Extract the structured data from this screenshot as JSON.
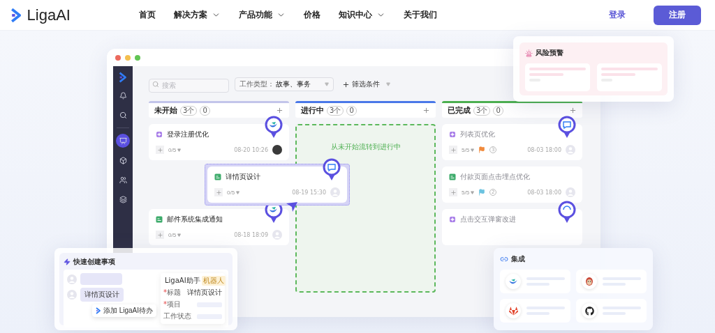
{
  "nav": {
    "logo": "LigaAI",
    "items": [
      {
        "label": "首页",
        "dropdown": false
      },
      {
        "label": "解决方案",
        "dropdown": true
      },
      {
        "label": "产品功能",
        "dropdown": true
      },
      {
        "label": "价格",
        "dropdown": false
      },
      {
        "label": "知识中心",
        "dropdown": true
      },
      {
        "label": "关于我们",
        "dropdown": false
      }
    ],
    "login": "登录",
    "signup": "注册"
  },
  "app": {
    "sidebar": {
      "items": [
        {
          "kind": "bell",
          "selected": false
        },
        {
          "kind": "search",
          "selected": false
        },
        {
          "kind": "board",
          "selected": true
        },
        {
          "kind": "cube",
          "selected": false
        },
        {
          "kind": "team",
          "selected": false
        },
        {
          "kind": "layers",
          "selected": false
        }
      ]
    },
    "search": {
      "placeholder": "搜索"
    },
    "filter": {
      "label": "工作类型：",
      "value": "故事、事务"
    },
    "filter_button": "筛选条件",
    "columns": [
      {
        "title": "未开始",
        "count": "3个",
        "badge": "0",
        "color": "#c3c5ea",
        "faded": false,
        "cards": [
          {
            "kind": "story",
            "title": "登录注册优化",
            "progress": "0/5",
            "date": "08-20 10:26",
            "avatar": {
              "kind": "photo"
            },
            "pin": {
              "kind": "bot"
            }
          },
          {
            "kind": "task",
            "title": "邮件系统集成通知",
            "progress": "0/5",
            "date": "08-18 18:09",
            "avatar": {
              "kind": "blank"
            },
            "pin": {
              "kind": "bot"
            }
          }
        ],
        "dragged_card": {
          "kind": "task",
          "title": "详情页设计",
          "progress": "0/5",
          "date": "08-19 15:30",
          "avatar": {
            "kind": "blank"
          },
          "pin": {
            "kind": "chat"
          }
        }
      },
      {
        "title": "进行中",
        "count": "3个",
        "badge": "0",
        "color": "#4a78e8",
        "drop_hint": "从未开始流转到进行中"
      },
      {
        "title": "已完成",
        "count": "3个",
        "badge": "0",
        "color": "#4caf50",
        "faded": true,
        "cards": [
          {
            "kind": "story",
            "title": "列表页优化",
            "progress": "5/5",
            "flag": {
              "color": "#f08a3c"
            },
            "comments": "3",
            "date": "08-03 18:00",
            "avatar": {
              "kind": "blank"
            },
            "pin": {
              "kind": "chat"
            }
          },
          {
            "kind": "task",
            "title": "付款页面点击埋点优化",
            "progress": "5/5",
            "flag": {
              "color": "#6cc3e0"
            },
            "comments": "2",
            "date": "08-03 18:00",
            "avatar": {
              "kind": "blank"
            }
          },
          {
            "kind": "story",
            "title": "点击交互弹窗改进",
            "pin": {
              "kind": "loading"
            }
          }
        ]
      }
    ]
  },
  "risk_panel": {
    "title": "风险预警"
  },
  "quick_create": {
    "title": "快速创建事项",
    "message": "详情页设计",
    "popup": "添加 LigaAI待办",
    "assistant": "LigaAI助手",
    "tag": "机器人",
    "fields": [
      {
        "mark": "*",
        "label": "标题",
        "value": "详情页设计"
      },
      {
        "mark": "*",
        "label": "项目"
      },
      {
        "label": "工作状态"
      }
    ]
  },
  "integrations": {
    "title": "集成",
    "items": [
      {
        "kind": "swoosh"
      },
      {
        "kind": "mascot"
      },
      {
        "kind": "fox"
      },
      {
        "kind": "cat"
      }
    ]
  }
}
